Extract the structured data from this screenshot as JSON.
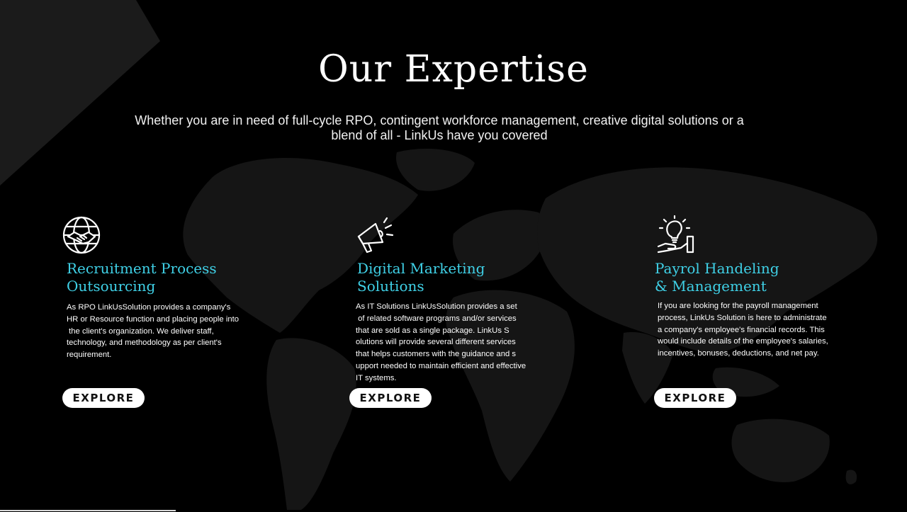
{
  "header": {
    "title": "Our Expertise",
    "subtitle_lines": [
      "Whether you are in need of full-cycle RPO, contingent workforce management, creative digital solutions or a",
      "blend of all - LinkUs have you covered"
    ]
  },
  "cards": [
    {
      "icon": "handshake-globe-icon",
      "title_lines": [
        "Recruitment Process",
        "Outsourcing"
      ],
      "desc_lines": [
        "As RPO LinkUsSolution provides a company's",
        "HR or Resource function and placing people into",
        " the client's organization. We deliver staff,",
        "technology, and methodology as per client's",
        "requirement."
      ],
      "button_label": "EXPLORE"
    },
    {
      "icon": "megaphone-icon",
      "title_lines": [
        "Digital Marketing",
        "Solutions"
      ],
      "desc_lines": [
        "As IT Solutions LinkUsSolution provides a set",
        " of related software programs and/or services",
        "that are sold as a single package. LinkUs S",
        "olutions will provide several different services",
        "that helps customers with the guidance and s",
        "upport needed to maintain efficient and effective",
        "IT systems."
      ],
      "button_label": "EXPLORE"
    },
    {
      "icon": "lightbulb-hand-icon",
      "title_lines": [
        "Payrol Handeling",
        "& Management"
      ],
      "desc_lines": [
        "If you are looking for the payroll management",
        "process, LinkUs Solution is here to administrate",
        "a company's employee's financial records. This",
        "would include details of the employee's salaries,",
        "incentives, bonuses, deductions, and net pay."
      ],
      "button_label": "EXPLORE"
    }
  ],
  "colors": {
    "background": "#000000",
    "accent": "#3fd0e6",
    "text": "#ffffff",
    "button_bg": "#ffffff",
    "map": "#1c1c1c"
  }
}
